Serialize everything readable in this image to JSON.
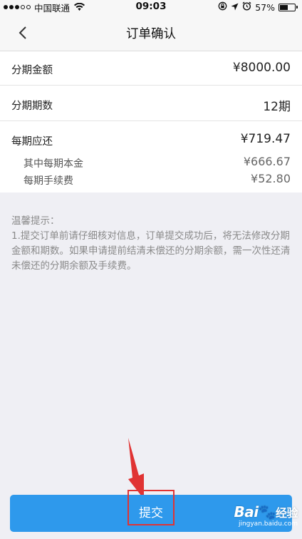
{
  "status_bar": {
    "carrier": "中国联通",
    "time": "09:03",
    "battery": "57%",
    "battery_level": 0.57,
    "signal_bars_filled": 3,
    "signal_bars_total": 5
  },
  "nav": {
    "title": "订单确认",
    "back_icon": "chevron-left-icon"
  },
  "order": {
    "amount_label": "分期金额",
    "amount_value": "¥8000.00",
    "periods_label": "分期期数",
    "periods_value": "12期",
    "per_period_label": "每期应还",
    "per_period_value": "¥719.47",
    "principal_label": "其中每期本金",
    "principal_value": "¥666.67",
    "fee_label": "每期手续费",
    "fee_value": "¥52.80"
  },
  "tips": {
    "title": "温馨提示：",
    "line1": "1.提交订单前请仔细核对信息，订单提交成功后，将无法修改分期金额和期数。如果申请提前结清未偿还的分期余额，需一次性还清未偿还的分期余额及手续费。"
  },
  "submit": {
    "label": "提交"
  },
  "watermark": {
    "logo": "Bai",
    "logo_suffix": "经验",
    "url": "jingyan.baidu.com"
  },
  "colors": {
    "accent": "#2e99ec",
    "annotation": "#e03333",
    "background": "#efeff4"
  }
}
